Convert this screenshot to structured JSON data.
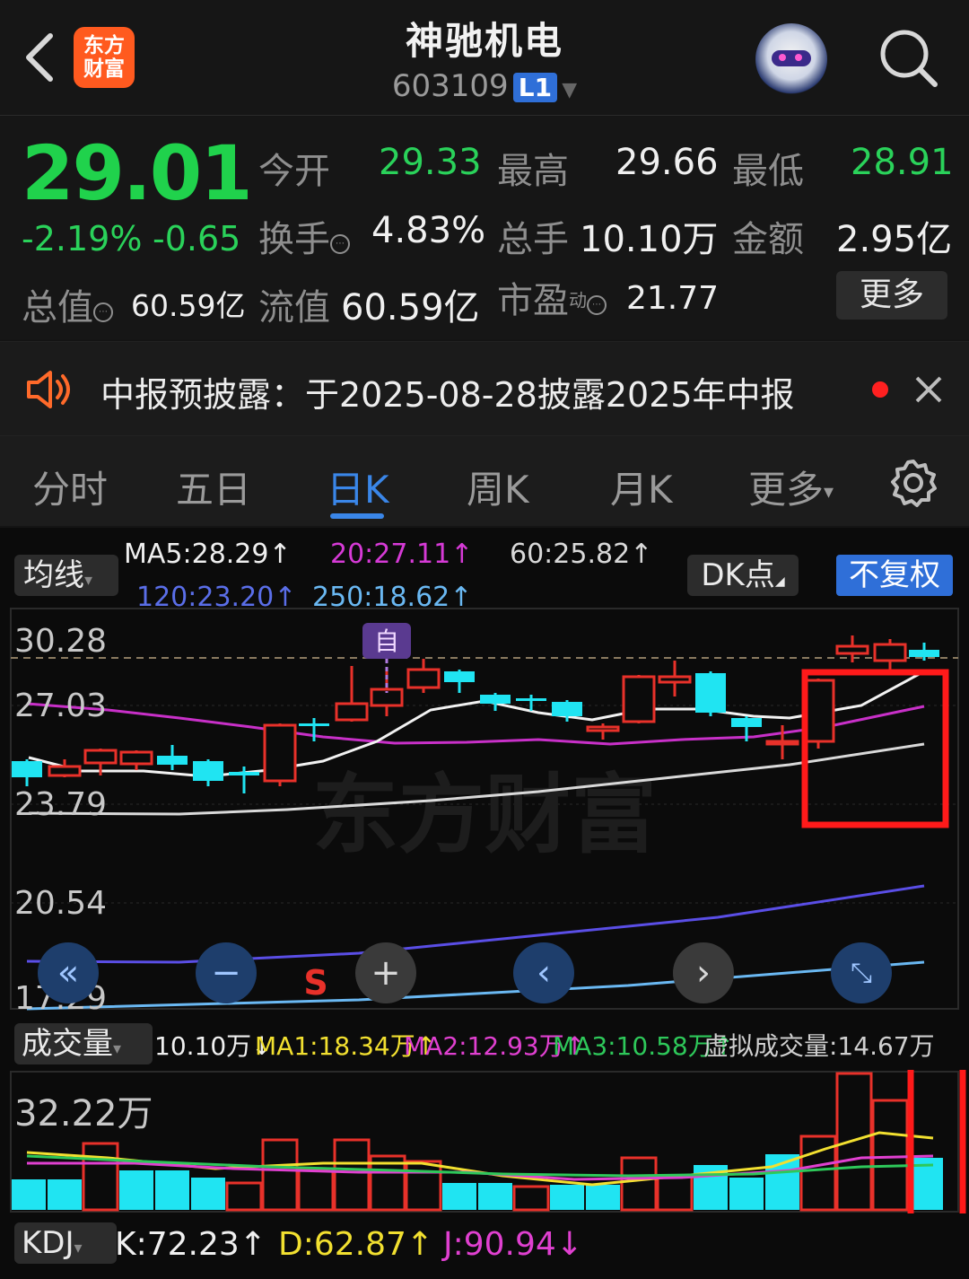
{
  "header": {
    "back_icon": "chevron-left-icon",
    "app_logo": "东方财富",
    "title": "神驰机电",
    "code": "603109",
    "level": "L1",
    "search_icon": "search-icon"
  },
  "quote": {
    "price": "29.01",
    "change_pct": "-2.19%",
    "change": "-0.65",
    "open_label": "今开",
    "open": "29.33",
    "high_label": "最高",
    "high": "29.66",
    "low_label": "最低",
    "low": "28.91",
    "turnover_label": "换手",
    "turnover": "4.83%",
    "volume_label": "总手",
    "volume": "10.10万",
    "amount_label": "金额",
    "amount": "2.95亿",
    "mcap_label": "总值",
    "mcap": "60.59亿",
    "float_label": "流值",
    "float": "60.59亿",
    "pe_label": "市盈",
    "pe_sup": "动",
    "pe": "21.77",
    "more_label": "更多"
  },
  "notice": {
    "text": "中报预披露：于2025-08-28披露2025年中报"
  },
  "tabs": [
    "分时",
    "五日",
    "日K",
    "周K",
    "月K",
    "更多"
  ],
  "active_tab": "日K",
  "kline": {
    "ma_selector": "均线",
    "ma5": "MA5:28.29↑",
    "ma20": "20:27.11↑",
    "ma60": "60:25.82↑",
    "ma120": "120:23.20↑",
    "ma250": "250:18.62↑",
    "dk_label": "DK点",
    "adj_label": "不复权",
    "y_labels": [
      "30.28",
      "27.03",
      "23.79",
      "20.54",
      "17.29"
    ],
    "marker_self": "自",
    "marker_s": "S",
    "watermark": "东方财富"
  },
  "volume": {
    "selector": "成交量",
    "vol": "10.10万↓",
    "ma1": "MA1:18.34万↑",
    "ma2": "MA2:12.93万↑",
    "ma3": "MA3:10.58万↑",
    "virtual": "虚拟成交量:14.67万",
    "max_label": "32.22万"
  },
  "kdj": {
    "selector": "KDJ",
    "k": "K:72.23↑",
    "d": "D:62.87↑",
    "j": "J:90.94↓"
  },
  "colors": {
    "up": "#e8312a",
    "down": "#20e4f2",
    "green": "#2ad25a",
    "accent": "#3a86e8"
  }
}
